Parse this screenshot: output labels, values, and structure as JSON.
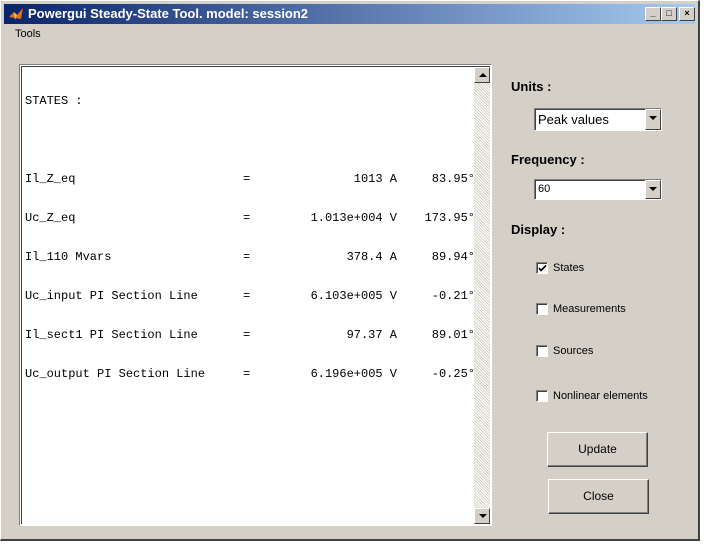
{
  "window": {
    "title": "Powergui Steady-State Tool. model: session2",
    "controls": {
      "minimize": "_",
      "maximize": "□",
      "close": "×"
    }
  },
  "menu": {
    "tools": "Tools"
  },
  "output": {
    "header": "STATES :",
    "rows": [
      {
        "name": "Il_Z_eq",
        "eq": "=",
        "value": "1013 A",
        "phase": "83.95°"
      },
      {
        "name": "Uc_Z_eq",
        "eq": "=",
        "value": "1.013e+004 V",
        "phase": "173.95°"
      },
      {
        "name": "Il_110 Mvars",
        "eq": "=",
        "value": "378.4 A",
        "phase": "89.94°"
      },
      {
        "name": "Uc_input PI Section Line",
        "eq": "=",
        "value": "6.103e+005 V",
        "phase": "-0.21°"
      },
      {
        "name": "Il_sect1 PI Section Line",
        "eq": "=",
        "value": "97.37 A",
        "phase": "89.01°"
      },
      {
        "name": "Uc_output PI Section Line",
        "eq": "=",
        "value": "6.196e+005 V",
        "phase": "-0.25°"
      }
    ]
  },
  "units": {
    "label": "Units :",
    "selected": "Peak values"
  },
  "frequency": {
    "label": "Frequency :",
    "selected": "60"
  },
  "display": {
    "label": "Display :",
    "options": [
      {
        "label": "States",
        "checked": true
      },
      {
        "label": "Measurements",
        "checked": false
      },
      {
        "label": "Sources",
        "checked": false
      },
      {
        "label": "Nonlinear elements",
        "checked": false
      }
    ]
  },
  "buttons": {
    "update": "Update",
    "close": "Close"
  }
}
